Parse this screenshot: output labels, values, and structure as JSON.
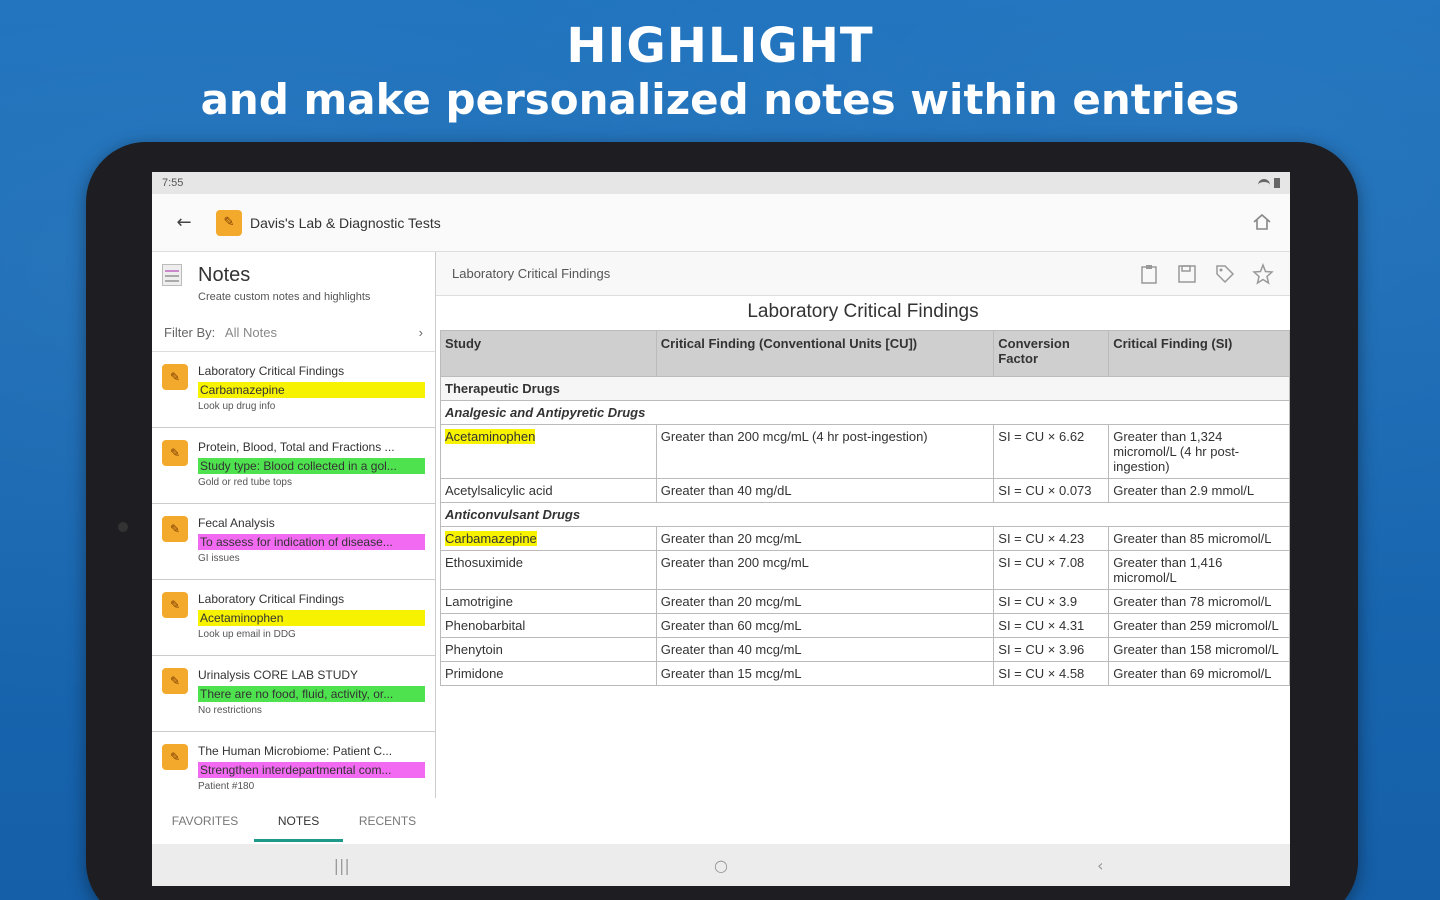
{
  "promo": {
    "headline": "HIGHLIGHT",
    "subheadline": "and make personalized notes within entries"
  },
  "status": {
    "time": "7:55"
  },
  "appbar": {
    "title": "Davis's Lab & Diagnostic Tests"
  },
  "notes_panel": {
    "title": "Notes",
    "subtitle": "Create custom notes and highlights",
    "filter_label": "Filter By:",
    "filter_value": "All Notes",
    "items": [
      {
        "title": "Laboratory Critical Findings",
        "highlight": "Carbamazepine",
        "color": "#f7f200",
        "sub": "Look up drug info"
      },
      {
        "title": "Protein, Blood, Total and Fractions ...",
        "highlight": "Study type: Blood collected in a gol...",
        "color": "#4ee24e",
        "sub": "Gold or red tube tops"
      },
      {
        "title": "Fecal Analysis",
        "highlight": "To assess for indication of disease...",
        "color": "#f26af2",
        "sub": "GI issues"
      },
      {
        "title": "Laboratory Critical Findings",
        "highlight": "Acetaminophen",
        "color": "#f7f200",
        "sub": "Look up email in DDG"
      },
      {
        "title": "Urinalysis CORE LAB STUDY",
        "highlight": "There are no food, fluid, activity, or...",
        "color": "#4ee24e",
        "sub": "No restrictions"
      },
      {
        "title": "The Human Microbiome: Patient C...",
        "highlight": "Strengthen interdepartmental com...",
        "color": "#f26af2",
        "sub": "Patient #180"
      }
    ],
    "tabs": [
      "FAVORITES",
      "NOTES",
      "RECENTS"
    ]
  },
  "entry": {
    "header": "Laboratory Critical Findings",
    "table_title": "Laboratory Critical Findings",
    "columns": [
      "Study",
      "Critical Finding (Conventional Units [CU])",
      "Conversion Factor",
      "Critical Finding (SI)"
    ],
    "sections": {
      "s1": "Therapeutic Drugs",
      "s2": "Analgesic and Antipyretic Drugs",
      "s3": "Anticonvulsant Drugs"
    },
    "rows_a": [
      {
        "study": "Acetaminophen",
        "cu": "Greater than 200 mcg/mL (4 hr post-ingestion)",
        "factor": "SI = CU × 6.62",
        "si": "Greater than 1,324 micromol/L (4 hr post-ingestion)",
        "hl": true
      },
      {
        "study": "Acetylsalicylic acid",
        "cu": "Greater than 40 mg/dL",
        "factor": "SI = CU × 0.073",
        "si": "Greater than 2.9 mmol/L",
        "hl": false
      }
    ],
    "rows_b": [
      {
        "study": "Carbamazepine",
        "cu": "Greater than 20 mcg/mL",
        "factor": "SI = CU × 4.23",
        "si": "Greater than 85 micromol/L",
        "hl": true
      },
      {
        "study": "Ethosuximide",
        "cu": "Greater than 200 mcg/mL",
        "factor": "SI = CU × 7.08",
        "si": "Greater than 1,416 micromol/L",
        "hl": false
      },
      {
        "study": "Lamotrigine",
        "cu": "Greater than 20 mcg/mL",
        "factor": "SI = CU × 3.9",
        "si": "Greater than 78 micromol/L",
        "hl": false
      },
      {
        "study": "Phenobarbital",
        "cu": "Greater than 60 mcg/mL",
        "factor": "SI = CU × 4.31",
        "si": "Greater than 259 micromol/L",
        "hl": false
      },
      {
        "study": "Phenytoin",
        "cu": "Greater than 40 mcg/mL",
        "factor": "SI = CU × 3.96",
        "si": "Greater than 158 micromol/L",
        "hl": false
      },
      {
        "study": "Primidone",
        "cu": "Greater than 15 mcg/mL",
        "factor": "SI = CU × 4.58",
        "si": "Greater than 69 micromol/L",
        "hl": false
      }
    ]
  }
}
